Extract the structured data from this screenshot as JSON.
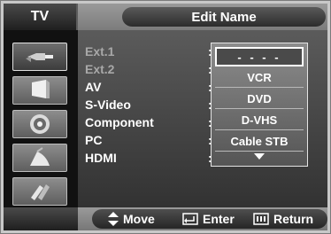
{
  "header": {
    "tab_label": "TV",
    "title": "Edit Name"
  },
  "sidebar": {
    "items": [
      {
        "icon": "input-plug-icon",
        "active": true
      },
      {
        "icon": "picture-icon",
        "active": false
      },
      {
        "icon": "sound-speaker-icon",
        "active": false
      },
      {
        "icon": "channel-satellite-icon",
        "active": false
      },
      {
        "icon": "setup-tools-icon",
        "active": false
      }
    ]
  },
  "sources": [
    {
      "label": "Ext.1",
      "value": "",
      "dim": true
    },
    {
      "label": "Ext.2",
      "value": "",
      "dim": true
    },
    {
      "label": "AV",
      "value": "",
      "dim": false
    },
    {
      "label": "S-Video",
      "value": "",
      "dim": false
    },
    {
      "label": "Component",
      "value": "",
      "dim": false
    },
    {
      "label": "PC",
      "value": "",
      "dim": false
    },
    {
      "label": "HDMI",
      "value": "- - - -",
      "dim": false
    }
  ],
  "colon": ":",
  "dropdown": {
    "options": [
      "- - - -",
      "VCR",
      "DVD",
      "D-VHS",
      "Cable STB"
    ],
    "selected_index": 0
  },
  "footer": {
    "move_label": "Move",
    "enter_label": "Enter",
    "return_label": "Return"
  }
}
